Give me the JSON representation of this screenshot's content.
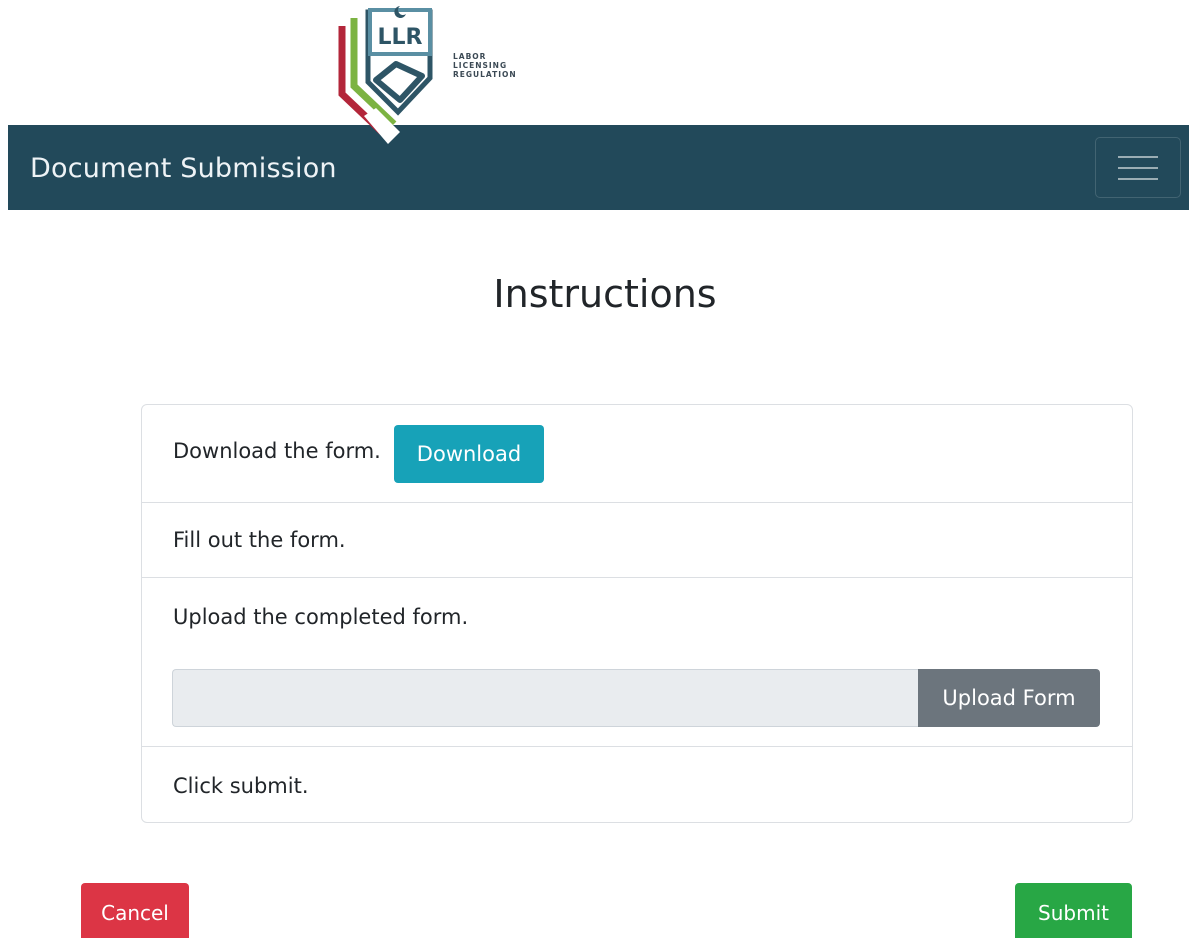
{
  "logo": {
    "abbrev": "LLR",
    "line1": "LABOR",
    "line2": "LICENSING",
    "line3": "REGULATION"
  },
  "navbar": {
    "brand": "Document Submission",
    "toggler_icon": "hamburger-menu-icon"
  },
  "main": {
    "heading": "Instructions",
    "steps": [
      {
        "text": "Download the form.",
        "button_label": "Download"
      },
      {
        "text": "Fill out the form."
      },
      {
        "text": "Upload the completed form.",
        "file_value": "",
        "button_label": "Upload Form"
      },
      {
        "text": "Click submit."
      }
    ]
  },
  "actions": {
    "cancel_label": "Cancel",
    "submit_label": "Submit"
  },
  "colors": {
    "navbar": "#22495a",
    "download": "#17a2b8",
    "upload": "#6c757d",
    "cancel": "#dc3545",
    "submit": "#28a745"
  }
}
